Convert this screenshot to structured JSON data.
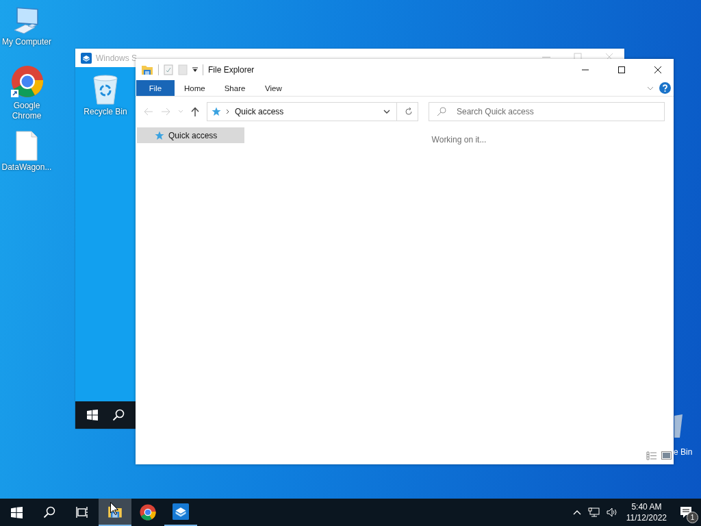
{
  "desktop_icons": [
    {
      "kind": "computer",
      "label": "My Computer"
    },
    {
      "kind": "chrome",
      "label": "Google Chrome"
    },
    {
      "kind": "file",
      "label": "DataWagon..."
    }
  ],
  "sandbox_window": {
    "title": "Windows S",
    "desktop_icons": [
      {
        "kind": "recycle",
        "label": "Recycle Bin"
      }
    ]
  },
  "explorer": {
    "title": "File Explorer",
    "tabs": [
      {
        "label": "File",
        "selected": true
      },
      {
        "label": "Home",
        "selected": false
      },
      {
        "label": "Share",
        "selected": false
      },
      {
        "label": "View",
        "selected": false
      }
    ],
    "address": "Quick access",
    "search": {
      "placeholder": "Search Quick access"
    },
    "nav_pane": [
      {
        "label": "Quick access",
        "selected": true
      }
    ],
    "status": "Working on it..."
  },
  "background_icon": {
    "kind": "recycle",
    "label": "e Bin"
  },
  "taskbar": {
    "apps": [
      {
        "kind": "explorer",
        "selected": true,
        "running": true
      },
      {
        "kind": "chrome",
        "selected": false,
        "running": false
      },
      {
        "kind": "sandbox",
        "selected": false,
        "running": true
      }
    ],
    "clock": {
      "time": "5:40 AM",
      "date": "11/12/2022"
    },
    "notification_count": "1"
  }
}
